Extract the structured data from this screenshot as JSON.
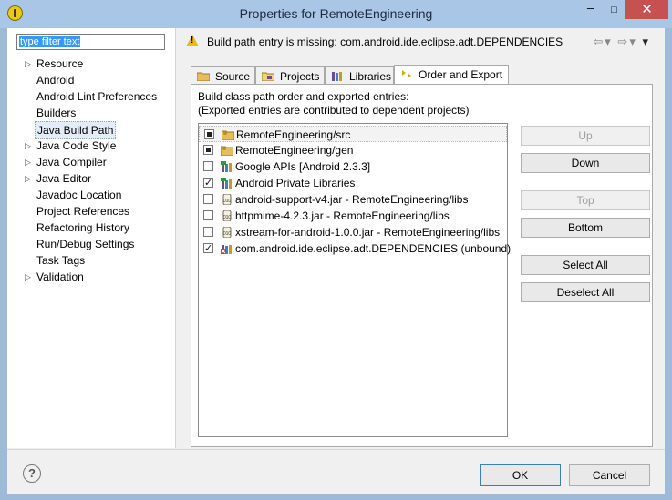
{
  "window": {
    "title": "Properties for RemoteEngineering",
    "controls": {
      "minimize": "–",
      "maximize": "□",
      "close": "✕"
    }
  },
  "filter": {
    "value": "type filter text"
  },
  "tree": {
    "items": [
      {
        "label": "Resource",
        "expandable": true
      },
      {
        "label": "Android",
        "expandable": false
      },
      {
        "label": "Android Lint Preferences",
        "expandable": false
      },
      {
        "label": "Builders",
        "expandable": false
      },
      {
        "label": "Java Build Path",
        "expandable": false,
        "selected": true
      },
      {
        "label": "Java Code Style",
        "expandable": true
      },
      {
        "label": "Java Compiler",
        "expandable": true
      },
      {
        "label": "Java Editor",
        "expandable": true
      },
      {
        "label": "Javadoc Location",
        "expandable": false
      },
      {
        "label": "Project References",
        "expandable": false
      },
      {
        "label": "Refactoring History",
        "expandable": false
      },
      {
        "label": "Run/Debug Settings",
        "expandable": false
      },
      {
        "label": "Task Tags",
        "expandable": false
      },
      {
        "label": "Validation",
        "expandable": true
      }
    ]
  },
  "message": {
    "text": "Build path entry is missing: com.android.ide.eclipse.adt.DEPENDENCIES"
  },
  "tabs": [
    {
      "label": "Source",
      "icon": "source-folder-icon"
    },
    {
      "label": "Projects",
      "icon": "projects-icon"
    },
    {
      "label": "Libraries",
      "icon": "libraries-icon"
    },
    {
      "label": "Order and Export",
      "icon": "order-export-icon",
      "active": true
    }
  ],
  "panel": {
    "description_line1": "Build class path order and exported entries:",
    "description_line2": "(Exported entries are contributed to dependent projects)"
  },
  "entries": [
    {
      "label": "RemoteEngineering/src",
      "state": "partial",
      "icon": "source-folder-icon"
    },
    {
      "label": "RemoteEngineering/gen",
      "state": "partial",
      "icon": "source-folder-icon"
    },
    {
      "label": "Google APIs [Android 2.3.3]",
      "state": "unchecked",
      "icon": "library-icon"
    },
    {
      "label": "Android Private Libraries",
      "state": "checked",
      "icon": "library-icon"
    },
    {
      "label": "android-support-v4.jar - RemoteEngineering/libs",
      "state": "unchecked",
      "icon": "jar-icon"
    },
    {
      "label": "httpmime-4.2.3.jar - RemoteEngineering/libs",
      "state": "unchecked",
      "icon": "jar-icon"
    },
    {
      "label": "xstream-for-android-1.0.0.jar - RemoteEngineering/libs",
      "state": "unchecked",
      "icon": "jar-icon"
    },
    {
      "label": "com.android.ide.eclipse.adt.DEPENDENCIES (unbound)",
      "state": "checked",
      "icon": "unbound-library-icon"
    }
  ],
  "buttons": {
    "up": "Up",
    "down": "Down",
    "top": "Top",
    "bottom": "Bottom",
    "select_all": "Select All",
    "deselect_all": "Deselect All"
  },
  "footer": {
    "help": "?",
    "ok": "OK",
    "cancel": "Cancel"
  }
}
